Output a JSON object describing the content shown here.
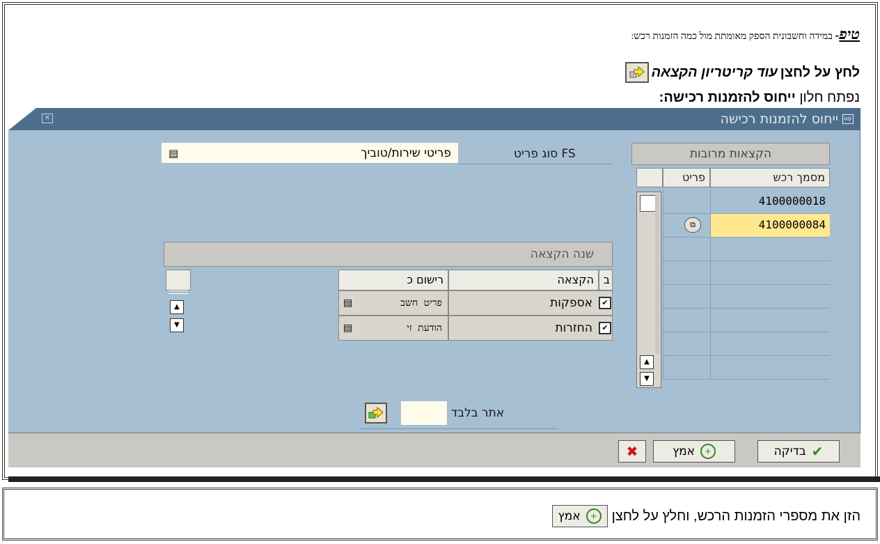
{
  "doc": {
    "tip_word": "טיפ",
    "tip_text": "במידה וחשבונית הספק מאומתת מול כמה הזמנות רכש:",
    "press_prefix": "לחץ על לחצן",
    "press_italic": "עוד קריטריון הקצאה",
    "opens_prefix": "נפתח חלון",
    "opens_bold": "ייחוס להזמנות רכישה:",
    "bottom_text": "הזן את מספרי הזמנות הרכש, וחלץ על לחצן"
  },
  "dialog": {
    "title": "ייחוס להזמנות רכישה",
    "multi_header": "הקצאות מרובות",
    "col_po": "מסמך רכש",
    "col_item": "פריט",
    "po_values": [
      "4100000018",
      "4100000084"
    ],
    "fs_label": "סוג פריט FS",
    "fs_value": "פריטי שירות/טוביך",
    "year_header": "שנה הקצאה",
    "year_cols": {
      "b": "ב",
      "assign": "הקצאה",
      "posting": "רישום כ"
    },
    "year_rows": [
      {
        "assign": "אספקות",
        "posting": "פריט חשב"
      },
      {
        "assign": "החזרות",
        "posting": "הודעת זי"
      }
    ],
    "site_label": "אתר בלבד",
    "buttons": {
      "check": "בדיקה",
      "accept": "אמץ"
    }
  },
  "colors": {
    "dialog_bg": "#a7bfd3",
    "titlebar": "#4d6f8d",
    "input_bg": "#fffbea",
    "highlight": "#ffe88f"
  }
}
